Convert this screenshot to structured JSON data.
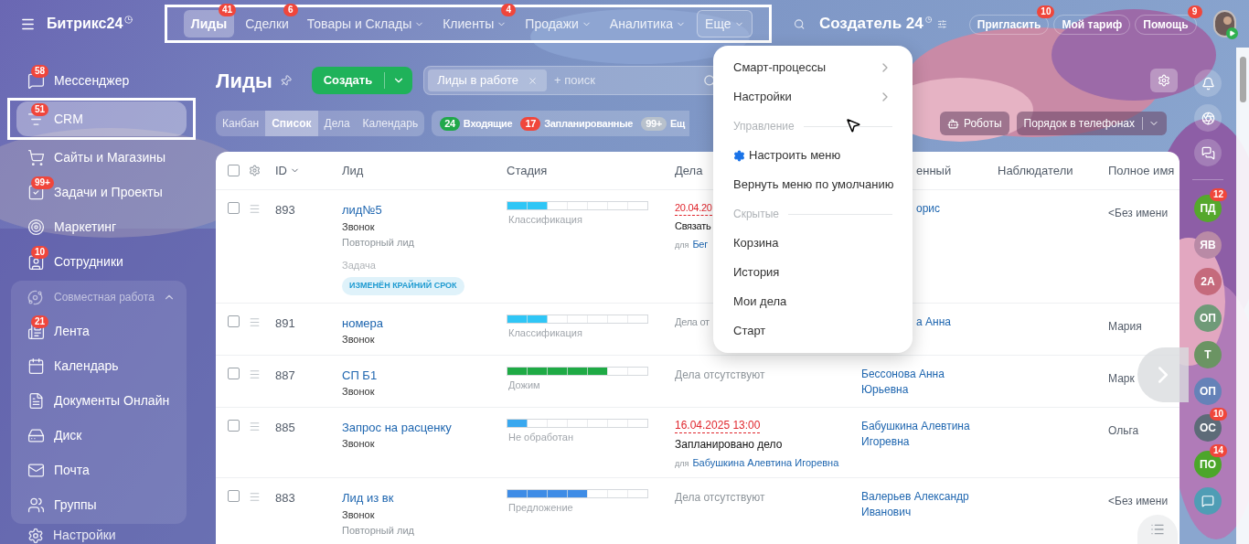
{
  "brand": {
    "name": "Битрикс24"
  },
  "top_nav": {
    "outlined": true,
    "items": [
      {
        "label": "Лиды",
        "badge": "41",
        "selected": true,
        "dropdown": false,
        "open": false
      },
      {
        "label": "Сделки",
        "badge": "6",
        "selected": false,
        "dropdown": false,
        "open": false
      },
      {
        "label": "Товары и Склады",
        "selected": false,
        "dropdown": true,
        "open": false
      },
      {
        "label": "Клиенты",
        "badge": "4",
        "selected": false,
        "dropdown": true,
        "open": false
      },
      {
        "label": "Продажи",
        "selected": false,
        "dropdown": true,
        "open": false
      },
      {
        "label": "Аналитика",
        "selected": false,
        "dropdown": true,
        "open": false
      },
      {
        "label": "Еще",
        "selected": false,
        "dropdown": true,
        "open": true
      }
    ]
  },
  "portal": {
    "title": "Создатель 24"
  },
  "header_buttons": [
    {
      "label": "Пригласить",
      "badge": "10"
    },
    {
      "label": "Мой тариф"
    },
    {
      "label": "Помощь",
      "badge": "9"
    }
  ],
  "sidebar": {
    "items": [
      {
        "label": "Мессенджер",
        "badge": "58",
        "selected": false,
        "outlined": false
      },
      {
        "label": "CRM",
        "badge": "51",
        "selected": true,
        "outlined": true
      },
      {
        "label": "Сайты и Магазины",
        "selected": false,
        "outlined": false
      },
      {
        "label": "Задачи и Проекты",
        "badge": "99+",
        "selected": false,
        "outlined": false
      },
      {
        "label": "Маркетинг",
        "selected": false,
        "outlined": false
      },
      {
        "label": "Сотрудники",
        "badge": "10",
        "selected": false,
        "outlined": false
      }
    ],
    "group": {
      "label": "Совместная работа",
      "expanded": true,
      "children": [
        {
          "label": "Лента",
          "badge": "21",
          "selected": false
        },
        {
          "label": "Календарь",
          "selected": false
        },
        {
          "label": "Документы Онлайн",
          "selected": false
        },
        {
          "label": "Диск",
          "selected": false
        },
        {
          "label": "Почта",
          "selected": false
        },
        {
          "label": "Группы",
          "selected": false
        }
      ]
    },
    "footer": {
      "label": "Настройки"
    }
  },
  "page": {
    "title": "Лиды",
    "create_button": "Создать",
    "filter": {
      "tag": "Лиды в работе",
      "placeholder": "+ поиск"
    }
  },
  "view_tabs": [
    {
      "label": "Канбан",
      "selected": false
    },
    {
      "label": "Список",
      "selected": true
    },
    {
      "label": "Дела",
      "selected": false
    },
    {
      "label": "Календарь",
      "selected": false
    }
  ],
  "counters": [
    {
      "count": "24",
      "label": "Входящие",
      "color": "#21a84a"
    },
    {
      "count": "17",
      "label": "Запланированные",
      "color": "#f0463b"
    },
    {
      "count": "99+",
      "label": "Ещ",
      "color": "#b8c1cc"
    }
  ],
  "toolbar_buttons": [
    {
      "label": "Роботы",
      "dropdown": false
    },
    {
      "label": "Порядок в телефонах",
      "dropdown": true
    }
  ],
  "table": {
    "all_checked": false,
    "columns": [
      "ID",
      "Лид",
      "Стадия",
      "Дела",
      "енный",
      "Наблюдатели",
      "Полное имя"
    ],
    "rows": [
      {
        "checked": false,
        "id": "893",
        "lead": {
          "title": "лид№5",
          "source": "Звонок",
          "repeat": "Повторный лид",
          "task_label": "Задача",
          "task_badge": "ИЗМЕНЁН КРАЙНИЙ СРОК"
        },
        "stage": {
          "label": "Классификация",
          "level": 0.2857,
          "color": "#2fc6f6"
        },
        "deals": {
          "kind": "planned",
          "cut": true,
          "date": "20.04.20",
          "text": "Связать",
          "for": "для",
          "person": "Бег"
        },
        "responsible": {
          "text": "орис",
          "cut": true
        },
        "full_name": "<Без имени"
      },
      {
        "checked": false,
        "id": "891",
        "lead": {
          "title": "номера",
          "source": "Звонок"
        },
        "stage": {
          "label": "Классификация",
          "level": 0.2857,
          "color": "#2fc6f6"
        },
        "deals": {
          "kind": "none",
          "cut": true,
          "text": "Дела от"
        },
        "responsible": {
          "text": "а Анна",
          "cut": true
        },
        "full_name": "Мария"
      },
      {
        "checked": false,
        "id": "887",
        "lead": {
          "title": "СП Б1",
          "source": "Звонок"
        },
        "stage": {
          "label": "Дожим",
          "level": 0.7143,
          "color": "#1faa45"
        },
        "deals": {
          "kind": "none",
          "cut": false,
          "text": "Дела отсутствуют"
        },
        "responsible": {
          "text": "Бессонова Анна Юрьевна",
          "cut": false
        },
        "full_name": "Марк"
      },
      {
        "checked": false,
        "id": "885",
        "lead": {
          "title": "Запрос на расценку",
          "source": "Звонок"
        },
        "stage": {
          "label": "Не обработан",
          "level": 0.1429,
          "color": "#39a8ef"
        },
        "deals": {
          "kind": "planned",
          "cut": false,
          "date": "16.04.2025 13:00",
          "text": "Запланировано дело",
          "for": "для",
          "person": "Бабушкина Алевтина Игоревна"
        },
        "responsible": {
          "text": "Бабушкина Алевтина Игоревна",
          "cut": false
        },
        "full_name": "Ольга"
      },
      {
        "checked": false,
        "id": "883",
        "lead": {
          "title": "Лид из вк",
          "source": "Звонок",
          "repeat": "Повторный лид"
        },
        "stage": {
          "label": "Предложение",
          "level": 0.5714,
          "color": "#3e8ce6"
        },
        "deals": {
          "kind": "none",
          "cut": false,
          "text": "Дела отсутствуют"
        },
        "responsible": {
          "text": "Валерьев Александр Иванович",
          "cut": false
        },
        "full_name": "<Без имени"
      }
    ]
  },
  "dropdown_menu": {
    "items": [
      {
        "kind": "submenu",
        "label": "Смарт-процессы"
      },
      {
        "kind": "submenu",
        "label": "Настройки"
      },
      {
        "kind": "section",
        "label": "Управление"
      },
      {
        "kind": "setting",
        "label": "Настроить меню"
      },
      {
        "kind": "item",
        "label": "Вернуть меню по умолчанию"
      },
      {
        "kind": "section",
        "label": "Скрытые"
      },
      {
        "kind": "item",
        "label": "Корзина"
      },
      {
        "kind": "item",
        "label": "История"
      },
      {
        "kind": "item",
        "label": "Мои дела"
      },
      {
        "kind": "item",
        "label": "Старт"
      }
    ]
  },
  "right_rail": {
    "contacts": [
      {
        "kind": "initials",
        "initials": "ПД",
        "color": "#55a82c",
        "badge": "12"
      },
      {
        "kind": "initials",
        "initials": "ЯВ",
        "color": "#b98aa6"
      },
      {
        "kind": "initials",
        "initials": "2А",
        "color": "#c56a7c"
      },
      {
        "kind": "initials",
        "initials": "ОП",
        "color": "#6f9a78"
      },
      {
        "kind": "initials",
        "initials": "Т",
        "color": "#6b9463"
      },
      {
        "kind": "initials",
        "initials": "ОП",
        "color": "#6582b8"
      },
      {
        "kind": "initials",
        "initials": "ОС",
        "color": "#5d6b78",
        "badge": "10"
      },
      {
        "kind": "initials",
        "initials": "ПО",
        "color": "#4ca62a",
        "badge": "14"
      },
      {
        "kind": "chat",
        "color": "#4f9db5"
      }
    ]
  }
}
